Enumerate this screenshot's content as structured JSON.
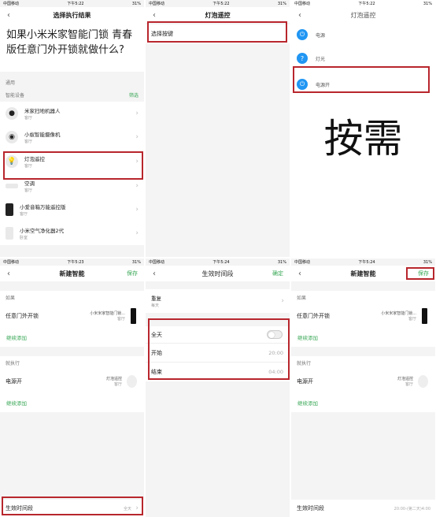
{
  "status": {
    "carrier": "中国移动",
    "time_a": "下午5:22",
    "time_b": "下午5:23",
    "time_c": "下午5:24",
    "battery": "31%"
  },
  "p1": {
    "title": "选择执行结果",
    "question": "如果小米米家智能门锁 青春版任意门外开锁就做什么?",
    "general": "通用",
    "smart_devices": "智能设备",
    "filter": "筛选",
    "devices": [
      {
        "name": "米家扫地机器人",
        "room": "客厅"
      },
      {
        "name": "小蚁智能摄像机",
        "room": "客厅"
      },
      {
        "name": "灯泡遥控",
        "room": "客厅"
      },
      {
        "name": "空调",
        "room": "客厅"
      },
      {
        "name": "小爱音箱万能遥控版",
        "room": "客厅"
      },
      {
        "name": "小米空气净化器2代",
        "room": "卧室"
      }
    ]
  },
  "p2": {
    "title": "灯泡遥控",
    "choose": "选择按键"
  },
  "p3": {
    "title": "灯泡遥控",
    "buttons": [
      {
        "icon": "⏻",
        "label": "电源"
      },
      {
        "icon": "?",
        "label": "灯光"
      },
      {
        "icon": "⏻",
        "label": "电源开"
      }
    ],
    "big_text": "按需"
  },
  "p4": {
    "title": "新建智能",
    "save": "保存",
    "if_label": "如果",
    "if_row": "任意门外开锁",
    "if_device": "小米米家智能门锁...",
    "if_room": "客厅",
    "add1": "继续添加",
    "then_label": "就执行",
    "then_row": "电源开",
    "then_device": "灯泡遥控",
    "then_room": "客厅",
    "add2": "继续添加",
    "period": "生效时间段",
    "period_value": "全天"
  },
  "p5": {
    "title": "生效时间段",
    "confirm": "确定",
    "repeat": "重复",
    "repeat_value": "每天",
    "allday": "全天",
    "start": "开始",
    "start_value": "20:00",
    "end": "结束",
    "end_value": "04:00"
  },
  "p6": {
    "title": "新建智能",
    "save": "保存",
    "if_label": "如果",
    "if_row": "任意门外开锁",
    "if_device": "小米米家智能门锁...",
    "if_room": "客厅",
    "add1": "继续添加",
    "then_label": "就执行",
    "then_row": "电源开",
    "then_device": "灯泡遥控",
    "then_room": "客厅",
    "add2": "继续添加",
    "period": "生效时间段",
    "period_value": "20:00-(第二天)4:00"
  },
  "colors": {
    "highlight": "#b8262d",
    "accent": "#3aa857",
    "blue": "#2196f3"
  }
}
